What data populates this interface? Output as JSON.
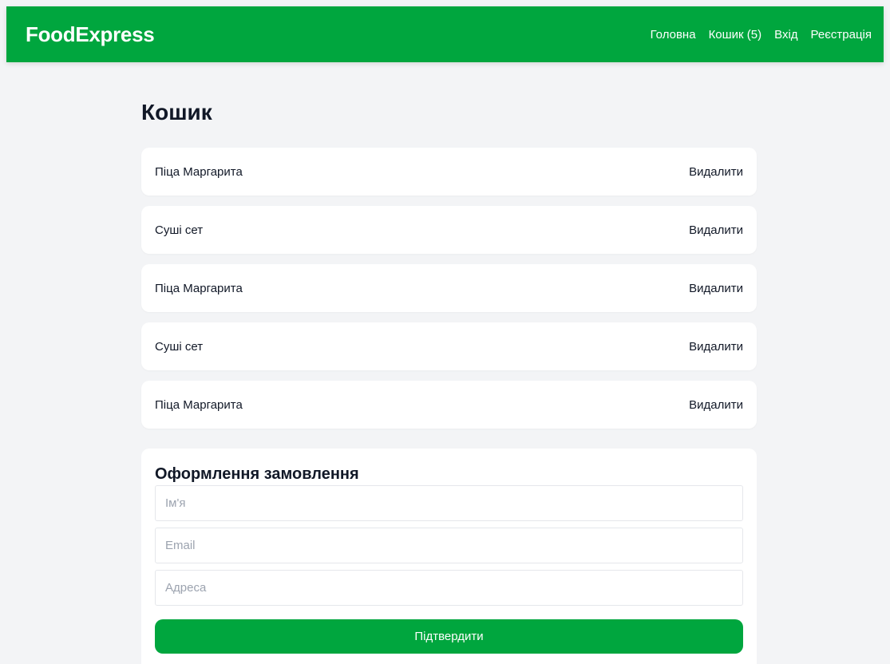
{
  "header": {
    "brand": "FoodExpress",
    "nav": [
      {
        "label": "Головна"
      },
      {
        "label": "Кошик (5)"
      },
      {
        "label": "Вхід"
      },
      {
        "label": "Реєстрація"
      }
    ],
    "accent_color": "#00a63e"
  },
  "cart": {
    "title": "Кошик",
    "remove_label": "Видалити",
    "items": [
      {
        "name": "Піца Маргарита"
      },
      {
        "name": "Суші сет"
      },
      {
        "name": "Піца Маргарита"
      },
      {
        "name": "Суші сет"
      },
      {
        "name": "Піца Маргарита"
      }
    ]
  },
  "checkout": {
    "title": "Оформлення замовлення",
    "name_placeholder": "Ім'я",
    "email_placeholder": "Email",
    "address_placeholder": "Адреса",
    "submit_label": "Підтвердити"
  }
}
